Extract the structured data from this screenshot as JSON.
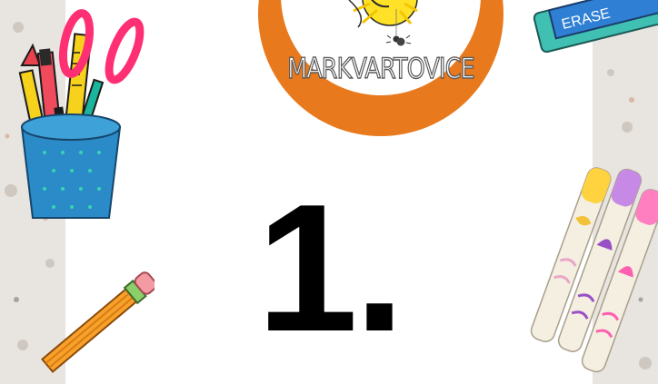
{
  "logo": {
    "school_name": "MARKVARTOVICE",
    "ring_color": "#e8791d"
  },
  "slide": {
    "number": "1."
  },
  "eraser": {
    "label": "ERASE"
  },
  "icons": [
    "pencil-cup-icon",
    "pencil-icon",
    "eraser-icon",
    "markers-icon",
    "sun-icon",
    "spider-icon"
  ]
}
